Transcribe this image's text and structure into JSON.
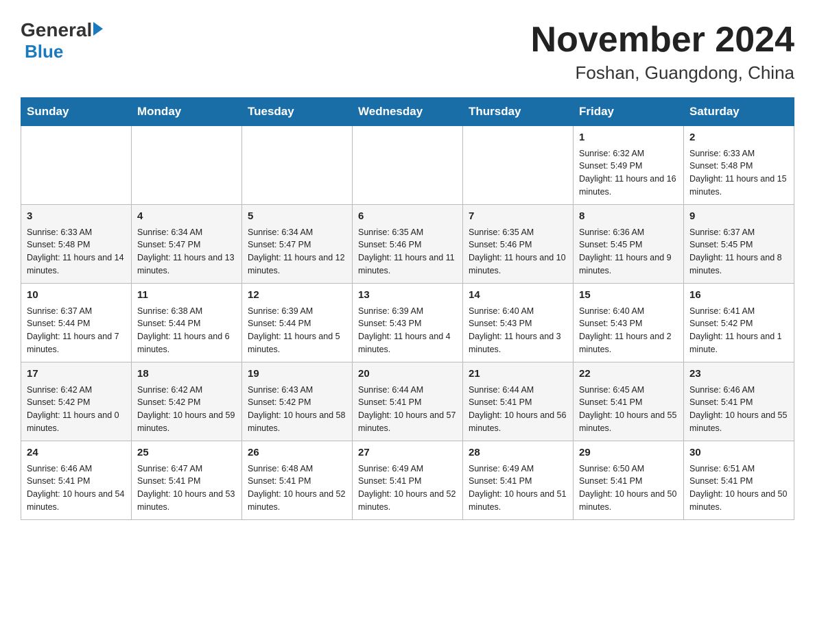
{
  "header": {
    "title": "November 2024",
    "subtitle": "Foshan, Guangdong, China",
    "logo_general": "General",
    "logo_blue": "Blue"
  },
  "days_of_week": [
    "Sunday",
    "Monday",
    "Tuesday",
    "Wednesday",
    "Thursday",
    "Friday",
    "Saturday"
  ],
  "weeks": [
    {
      "days": [
        {
          "num": "",
          "info": ""
        },
        {
          "num": "",
          "info": ""
        },
        {
          "num": "",
          "info": ""
        },
        {
          "num": "",
          "info": ""
        },
        {
          "num": "",
          "info": ""
        },
        {
          "num": "1",
          "info": "Sunrise: 6:32 AM\nSunset: 5:49 PM\nDaylight: 11 hours and 16 minutes."
        },
        {
          "num": "2",
          "info": "Sunrise: 6:33 AM\nSunset: 5:48 PM\nDaylight: 11 hours and 15 minutes."
        }
      ]
    },
    {
      "days": [
        {
          "num": "3",
          "info": "Sunrise: 6:33 AM\nSunset: 5:48 PM\nDaylight: 11 hours and 14 minutes."
        },
        {
          "num": "4",
          "info": "Sunrise: 6:34 AM\nSunset: 5:47 PM\nDaylight: 11 hours and 13 minutes."
        },
        {
          "num": "5",
          "info": "Sunrise: 6:34 AM\nSunset: 5:47 PM\nDaylight: 11 hours and 12 minutes."
        },
        {
          "num": "6",
          "info": "Sunrise: 6:35 AM\nSunset: 5:46 PM\nDaylight: 11 hours and 11 minutes."
        },
        {
          "num": "7",
          "info": "Sunrise: 6:35 AM\nSunset: 5:46 PM\nDaylight: 11 hours and 10 minutes."
        },
        {
          "num": "8",
          "info": "Sunrise: 6:36 AM\nSunset: 5:45 PM\nDaylight: 11 hours and 9 minutes."
        },
        {
          "num": "9",
          "info": "Sunrise: 6:37 AM\nSunset: 5:45 PM\nDaylight: 11 hours and 8 minutes."
        }
      ]
    },
    {
      "days": [
        {
          "num": "10",
          "info": "Sunrise: 6:37 AM\nSunset: 5:44 PM\nDaylight: 11 hours and 7 minutes."
        },
        {
          "num": "11",
          "info": "Sunrise: 6:38 AM\nSunset: 5:44 PM\nDaylight: 11 hours and 6 minutes."
        },
        {
          "num": "12",
          "info": "Sunrise: 6:39 AM\nSunset: 5:44 PM\nDaylight: 11 hours and 5 minutes."
        },
        {
          "num": "13",
          "info": "Sunrise: 6:39 AM\nSunset: 5:43 PM\nDaylight: 11 hours and 4 minutes."
        },
        {
          "num": "14",
          "info": "Sunrise: 6:40 AM\nSunset: 5:43 PM\nDaylight: 11 hours and 3 minutes."
        },
        {
          "num": "15",
          "info": "Sunrise: 6:40 AM\nSunset: 5:43 PM\nDaylight: 11 hours and 2 minutes."
        },
        {
          "num": "16",
          "info": "Sunrise: 6:41 AM\nSunset: 5:42 PM\nDaylight: 11 hours and 1 minute."
        }
      ]
    },
    {
      "days": [
        {
          "num": "17",
          "info": "Sunrise: 6:42 AM\nSunset: 5:42 PM\nDaylight: 11 hours and 0 minutes."
        },
        {
          "num": "18",
          "info": "Sunrise: 6:42 AM\nSunset: 5:42 PM\nDaylight: 10 hours and 59 minutes."
        },
        {
          "num": "19",
          "info": "Sunrise: 6:43 AM\nSunset: 5:42 PM\nDaylight: 10 hours and 58 minutes."
        },
        {
          "num": "20",
          "info": "Sunrise: 6:44 AM\nSunset: 5:41 PM\nDaylight: 10 hours and 57 minutes."
        },
        {
          "num": "21",
          "info": "Sunrise: 6:44 AM\nSunset: 5:41 PM\nDaylight: 10 hours and 56 minutes."
        },
        {
          "num": "22",
          "info": "Sunrise: 6:45 AM\nSunset: 5:41 PM\nDaylight: 10 hours and 55 minutes."
        },
        {
          "num": "23",
          "info": "Sunrise: 6:46 AM\nSunset: 5:41 PM\nDaylight: 10 hours and 55 minutes."
        }
      ]
    },
    {
      "days": [
        {
          "num": "24",
          "info": "Sunrise: 6:46 AM\nSunset: 5:41 PM\nDaylight: 10 hours and 54 minutes."
        },
        {
          "num": "25",
          "info": "Sunrise: 6:47 AM\nSunset: 5:41 PM\nDaylight: 10 hours and 53 minutes."
        },
        {
          "num": "26",
          "info": "Sunrise: 6:48 AM\nSunset: 5:41 PM\nDaylight: 10 hours and 52 minutes."
        },
        {
          "num": "27",
          "info": "Sunrise: 6:49 AM\nSunset: 5:41 PM\nDaylight: 10 hours and 52 minutes."
        },
        {
          "num": "28",
          "info": "Sunrise: 6:49 AM\nSunset: 5:41 PM\nDaylight: 10 hours and 51 minutes."
        },
        {
          "num": "29",
          "info": "Sunrise: 6:50 AM\nSunset: 5:41 PM\nDaylight: 10 hours and 50 minutes."
        },
        {
          "num": "30",
          "info": "Sunrise: 6:51 AM\nSunset: 5:41 PM\nDaylight: 10 hours and 50 minutes."
        }
      ]
    }
  ]
}
